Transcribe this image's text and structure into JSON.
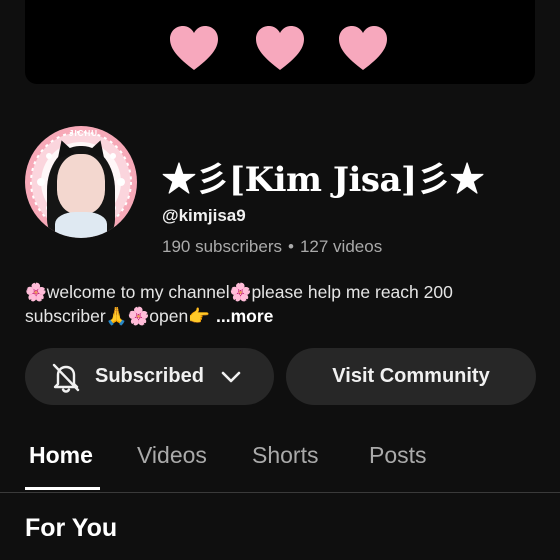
{
  "banner": {
    "hearts": [
      "heart-1",
      "heart-2",
      "heart-3"
    ],
    "heart_color": "#f7a8bd"
  },
  "avatar": {
    "tag_text": "JICHU"
  },
  "channel": {
    "name": "★彡[Kim Jisa]彡★",
    "handle": "@kimjisa9",
    "subscribers": "190 subscribers",
    "separator": "•",
    "videos": "127 videos"
  },
  "description": {
    "text": "🌸welcome to my channel🌸please help me reach 200 subscriber🙏🌸open👉",
    "more_label": "...more"
  },
  "buttons": {
    "subscribed_label": "Subscribed",
    "community_label": "Visit Community"
  },
  "tabs": [
    {
      "label": "Home",
      "active": true
    },
    {
      "label": "Videos",
      "active": false
    },
    {
      "label": "Shorts",
      "active": false
    },
    {
      "label": "Posts",
      "active": false
    }
  ],
  "section": {
    "title": "For You"
  },
  "colors": {
    "background": "#0f0f0f",
    "button_bg": "#272727",
    "muted_text": "#aaaaaa",
    "heart": "#f7a8bd"
  }
}
